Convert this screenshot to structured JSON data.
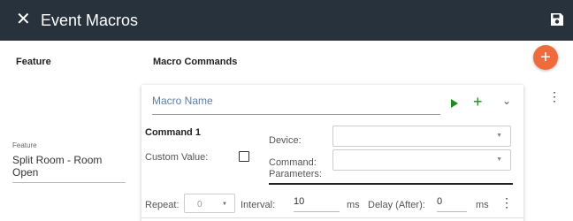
{
  "header": {
    "close_icon": "close-icon",
    "title": "Event Macros",
    "save_icon": "save-icon",
    "background": "#27323c"
  },
  "columns": {
    "feature": "Feature",
    "macro_commands": "Macro Commands"
  },
  "add_button": {
    "icon": "plus-icon",
    "glyph": "+",
    "color": "#ef6a3c"
  },
  "feature_field": {
    "label": "Feature",
    "value": "Split Room - Room Open"
  },
  "macro": {
    "name_placeholder": "Macro Name",
    "actions": {
      "play_icon": "play-icon",
      "add_glyph": "+",
      "expand_glyph": "⌄",
      "accent": "#1f8a1f"
    },
    "more_glyph": "⋮",
    "command": {
      "title": "Command 1",
      "custom_value_label": "Custom Value:",
      "device_label": "Device:",
      "device_value": "",
      "command_label_line1": "Command:",
      "command_label_line2": "Parameters:",
      "command_value": "",
      "select_arrow": "▼",
      "repeat_label": "Repeat:",
      "repeat_value": "0",
      "interval_label": "Interval:",
      "interval_value": "10",
      "interval_unit": "ms",
      "delay_label": "Delay (After):",
      "delay_value": "0",
      "delay_unit": "ms",
      "more_glyph": "⋮"
    }
  }
}
